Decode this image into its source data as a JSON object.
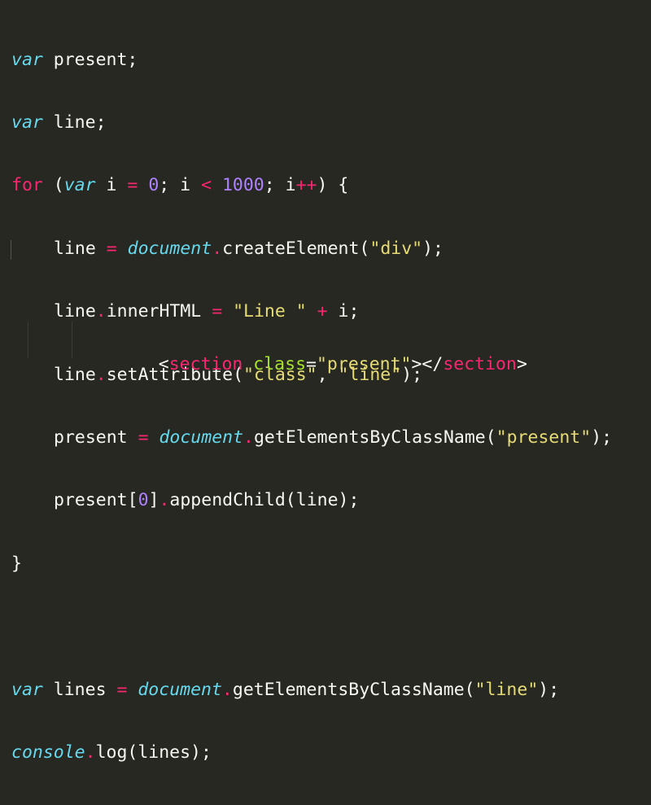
{
  "editor": {
    "js_lines": [
      [
        "var",
        " present;"
      ],
      [
        "var",
        " line;"
      ],
      [
        "for",
        " (",
        "var",
        " i ",
        "=",
        " ",
        "0",
        "; i ",
        "<",
        " ",
        "1000",
        "; i",
        "++",
        ") {"
      ],
      [
        "line ",
        "=",
        " ",
        "document",
        ".",
        "createElement(",
        "\"div\"",
        ");"
      ],
      [
        "line",
        ".",
        "innerHTML ",
        "=",
        " ",
        "\"Line \"",
        " ",
        "+",
        " i;"
      ],
      [
        "line",
        ".",
        "setAttribute(",
        "\"class\"",
        ", ",
        "\"line\"",
        ");"
      ],
      [
        "present ",
        "=",
        " ",
        "document",
        ".",
        "getElementsByClassName(",
        "\"present\"",
        ");"
      ],
      [
        "present[",
        "0",
        "]",
        ".",
        "appendChild(line);"
      ],
      [
        "}"
      ],
      [
        ""
      ],
      [
        "var",
        " lines ",
        "=",
        " ",
        "document",
        ".",
        "getElementsByClassName(",
        "\"line\"",
        ");"
      ],
      [
        "console",
        ".",
        "log(lines);"
      ]
    ],
    "html_line": {
      "open_bracket": "<",
      "tag": "section",
      "space": " ",
      "attr": "class",
      "eq": "=",
      "value": "\"present\"",
      "close_open": "></",
      "tag_close": "section",
      "end": ">"
    }
  },
  "colors": {
    "background": "#272822",
    "text": "#f8f8f2",
    "keyword": "#66d9ef",
    "control": "#f92672",
    "number": "#ae81ff",
    "string": "#e6db74",
    "attribute": "#a6e22e"
  }
}
